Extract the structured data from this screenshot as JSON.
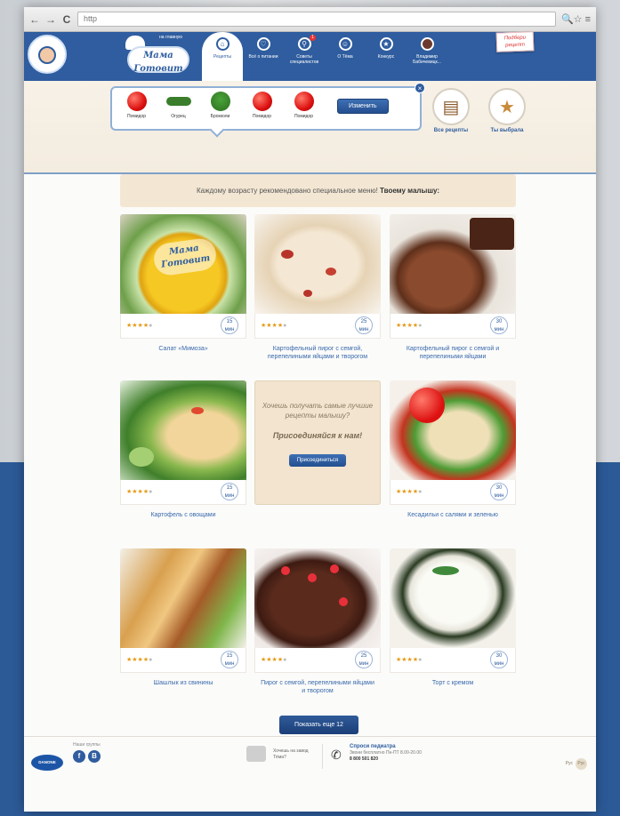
{
  "browser": {
    "back": "←",
    "forward": "→",
    "reload": "C",
    "url": "http",
    "tools": "🔍☆ ≡"
  },
  "header": {
    "logo_small": "на главную",
    "logo_text_1": "Мама",
    "logo_text_2": "Готовит",
    "nav": [
      {
        "label": "Рецепты",
        "icon": "⌂"
      },
      {
        "label": "Всё о питании",
        "icon": "♡"
      },
      {
        "label": "Советы специалистов",
        "icon": "⚲",
        "notif": "1"
      },
      {
        "label": "О Тёма",
        "icon": "☺"
      },
      {
        "label": "Конкурс",
        "icon": "★"
      },
      {
        "label": "Владимир Бабичевицк...",
        "icon": ""
      }
    ],
    "promo": "Подбери рецепт"
  },
  "picker": {
    "items": [
      {
        "label": "Помидор",
        "kind": "tomato"
      },
      {
        "label": "Огурец",
        "kind": "cucumber"
      },
      {
        "label": "Брокколи",
        "kind": "broccoli"
      },
      {
        "label": "Помидор",
        "kind": "tomato"
      },
      {
        "label": "Помидор",
        "kind": "tomato"
      }
    ],
    "change_label": "Изменить",
    "close": "×",
    "all_recipes": "Все рецепты",
    "your_choice": "Ты выбрала"
  },
  "banner": {
    "text": "Каждому возрасту рекомендовано специальное меню!",
    "bold": "Твоему малышу:"
  },
  "cards": [
    {
      "title": "Салат «Мимоза»",
      "stars": 4,
      "time": "15",
      "unit": "мин"
    },
    {
      "title": "Картофельный пирог с семгой, перепелиными яйцами и творогом",
      "stars": 4,
      "time": "25",
      "unit": "мин"
    },
    {
      "title": "Картофельный пирог с семгой и перепелиными яйцами",
      "stars": 4,
      "time": "30",
      "unit": "мин"
    },
    {
      "title": "Картофель с овощами",
      "stars": 4,
      "time": "15",
      "unit": "мин"
    },
    {
      "title": "Кесадильи с салями и зеленью",
      "stars": 4,
      "time": "30",
      "unit": "мин"
    },
    {
      "title": "Шашлык из свинины",
      "stars": 4,
      "time": "15",
      "unit": "мин"
    },
    {
      "title": "Пирог с семгой, перепелиными яйцами и творогом",
      "stars": 4,
      "time": "25",
      "unit": "мин"
    },
    {
      "title": "Торт с кремом",
      "stars": 4,
      "time": "30",
      "unit": "мин"
    }
  ],
  "join": {
    "question": "Хочешь получать самые лучшие рецепты малышу?",
    "cta": "Присоединяйся к нам!",
    "button": "Присоединиться"
  },
  "more_button": "Показать еще 12",
  "footer": {
    "danone": "DANONE",
    "social_label": "Наши группы",
    "fb": "f",
    "vk": "B",
    "ask": "Хочешь на завод Тёма?",
    "pediatr_title": "Спроси педиатра",
    "pediatr_desc": "Звони бесплатно Пн-ПТ 8.00-20.00",
    "pediatr_phone": "8 800 501 820",
    "lang_label": "Рус",
    "lang_alt": "Рус"
  },
  "colors": {
    "brand_blue": "#2f5d9f",
    "star": "#e69a16",
    "beige": "#f3e7d4"
  }
}
